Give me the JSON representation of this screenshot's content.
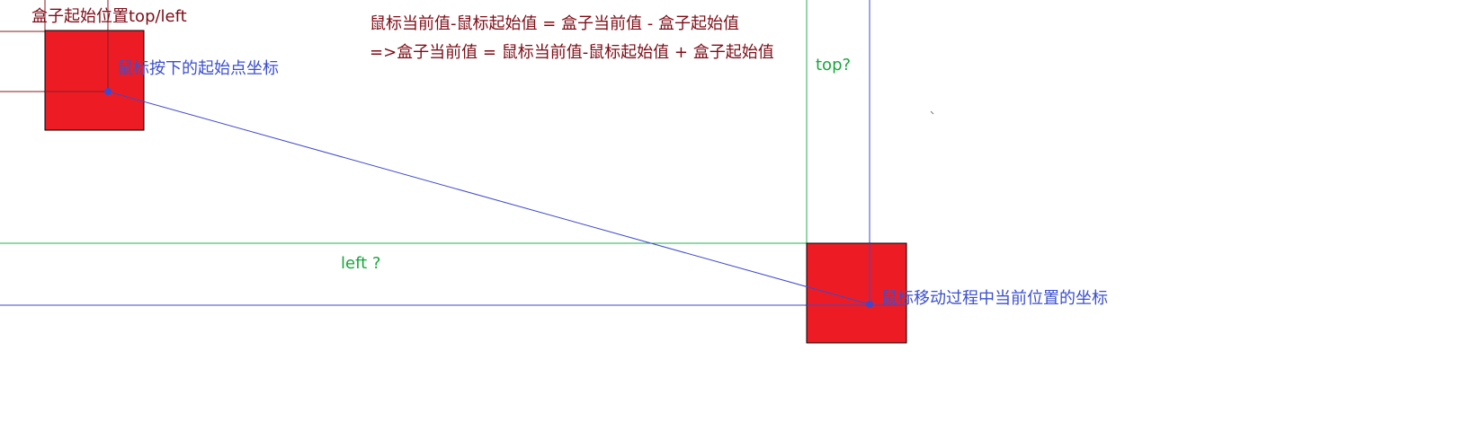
{
  "labels": {
    "start_position": "盒子起始位置top/left",
    "formula_line1": "鼠标当前值-鼠标起始值 = 盒子当前值 - 盒子起始值",
    "formula_line2": "=>盒子当前值 = 鼠标当前值-鼠标起始值 + 盒子起始值",
    "top_question": "top?",
    "left_question": "left ?",
    "mouse_start_point": "鼠标按下的起始点坐标",
    "mouse_current_point": "鼠标移动过程中当前位置的坐标"
  },
  "colors": {
    "box_fill": "#ed1c24",
    "box_border": "#000000",
    "start_guides": "#8b1a22",
    "offset_guides": "#22b14c",
    "mouse_guides": "#3f48cc",
    "formula_text": "#7d0d16",
    "green_text": "#18a63c",
    "blue_text": "#3b4fd0"
  }
}
